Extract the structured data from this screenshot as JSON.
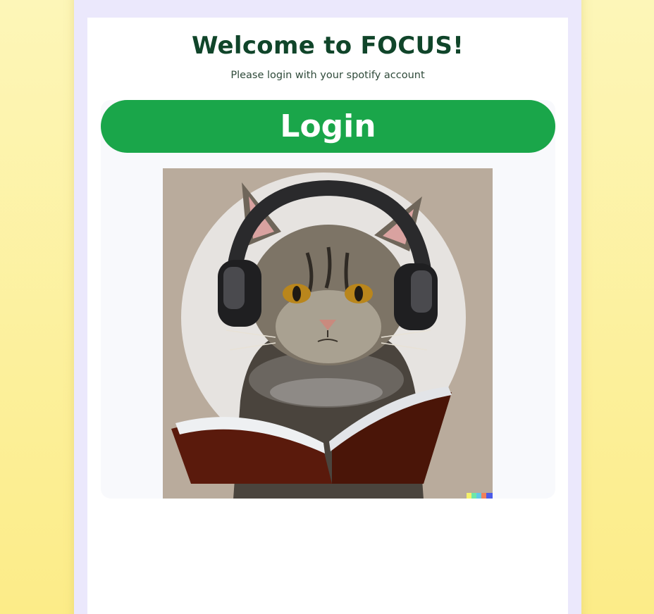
{
  "page": {
    "title": "Welcome to FOCUS!",
    "subtitle": "Please login with your spotify account"
  },
  "login": {
    "label": "Login"
  },
  "image": {
    "description_icon": "cat-with-headphones-reading-book-illustration"
  },
  "colors": {
    "background_top": "#fdf6b8",
    "background_bottom": "#fcec88",
    "frame": "#ebe8fc",
    "title": "#10452a",
    "login_button": "#1aa64a",
    "image_background": "#b9ab9c"
  }
}
